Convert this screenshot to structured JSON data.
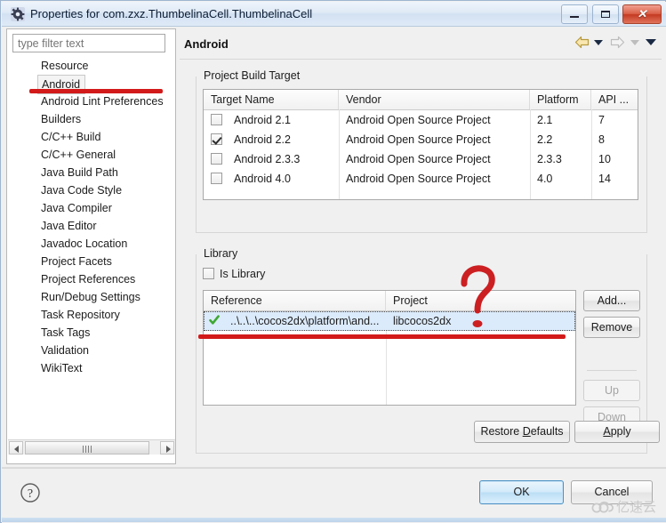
{
  "window": {
    "title": "Properties for com.zxz.ThumbelinaCell.ThumbelinaCell",
    "icon": "gear-icon",
    "minimize_label": "Minimize",
    "restore_label": "Restore",
    "close_label": "Close",
    "close_glyph": "✕"
  },
  "sidebar": {
    "filter": {
      "value": "",
      "placeholder": "type filter text"
    },
    "items": [
      {
        "label": "Resource",
        "selected": false
      },
      {
        "label": "Android",
        "selected": true
      },
      {
        "label": "Android Lint Preferences",
        "selected": false
      },
      {
        "label": "Builders",
        "selected": false
      },
      {
        "label": "C/C++ Build",
        "selected": false
      },
      {
        "label": "C/C++ General",
        "selected": false
      },
      {
        "label": "Java Build Path",
        "selected": false
      },
      {
        "label": "Java Code Style",
        "selected": false
      },
      {
        "label": "Java Compiler",
        "selected": false
      },
      {
        "label": "Java Editor",
        "selected": false
      },
      {
        "label": "Javadoc Location",
        "selected": false
      },
      {
        "label": "Project Facets",
        "selected": false
      },
      {
        "label": "Project References",
        "selected": false
      },
      {
        "label": "Run/Debug Settings",
        "selected": false
      },
      {
        "label": "Task Repository",
        "selected": false
      },
      {
        "label": "Task Tags",
        "selected": false
      },
      {
        "label": "Validation",
        "selected": false
      },
      {
        "label": "WikiText",
        "selected": false
      }
    ]
  },
  "page": {
    "title": "Android",
    "nav": {
      "back": "back-arrow",
      "back_menu": "chevron-down-icon",
      "forward": "forward-arrow",
      "forward_menu": "chevron-down-icon",
      "view_menu": "chevron-down-icon"
    }
  },
  "build_target": {
    "group_label": "Project Build Target",
    "columns": [
      "Target Name",
      "Vendor",
      "Platform",
      "API ..."
    ],
    "rows": [
      {
        "checked": false,
        "name": "Android 2.1",
        "vendor": "Android Open Source Project",
        "platform": "2.1",
        "api": "7"
      },
      {
        "checked": true,
        "name": "Android 2.2",
        "vendor": "Android Open Source Project",
        "platform": "2.2",
        "api": "8"
      },
      {
        "checked": false,
        "name": "Android 2.3.3",
        "vendor": "Android Open Source Project",
        "platform": "2.3.3",
        "api": "10"
      },
      {
        "checked": false,
        "name": "Android 4.0",
        "vendor": "Android Open Source Project",
        "platform": "4.0",
        "api": "14"
      }
    ]
  },
  "library": {
    "group_label": "Library",
    "is_library": {
      "label": "Is Library",
      "checked": false
    },
    "columns": [
      "Reference",
      "Project"
    ],
    "rows": [
      {
        "status": "check-green",
        "reference": "..\\..\\..\\cocos2dx\\platform\\and...",
        "project": "libcocos2dx",
        "selected": true
      }
    ],
    "buttons": [
      {
        "label": "Add...",
        "enabled": true
      },
      {
        "label": "Remove",
        "enabled": true
      },
      {
        "label": "Up",
        "enabled": false
      },
      {
        "label": "Down",
        "enabled": false
      }
    ]
  },
  "actions": {
    "restore_defaults": "Restore Defaults",
    "restore_defaults_mnemonic": "D",
    "apply": "Apply",
    "apply_mnemonic": "A",
    "ok": "OK",
    "cancel": "Cancel",
    "help": "help-icon"
  },
  "watermark": {
    "text": "亿速云"
  },
  "annotations": {
    "android_underline": "red-underline",
    "row_underline": "red-underline",
    "question_mark": "red-question-mark"
  },
  "colors": {
    "annotation_red": "#d31a1a",
    "selection_blue": "#dcebfb",
    "title_gradient_top": "#eef4fb",
    "ok_button_blue": "#bcdef5",
    "check_green": "#3fa832"
  }
}
